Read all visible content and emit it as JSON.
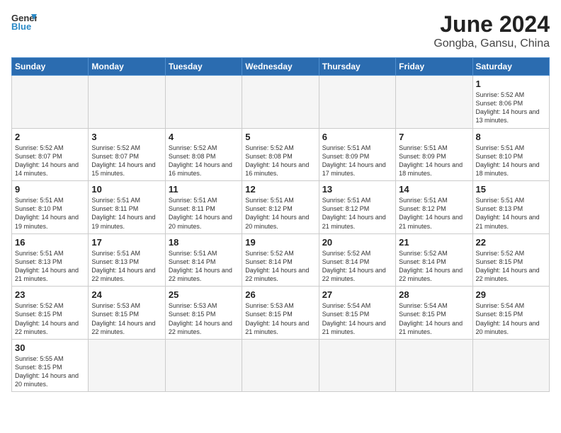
{
  "header": {
    "title": "June 2024",
    "location": "Gongba, Gansu, China",
    "logo_general": "General",
    "logo_blue": "Blue"
  },
  "days_of_week": [
    "Sunday",
    "Monday",
    "Tuesday",
    "Wednesday",
    "Thursday",
    "Friday",
    "Saturday"
  ],
  "weeks": [
    [
      {
        "day": "",
        "info": ""
      },
      {
        "day": "",
        "info": ""
      },
      {
        "day": "",
        "info": ""
      },
      {
        "day": "",
        "info": ""
      },
      {
        "day": "",
        "info": ""
      },
      {
        "day": "",
        "info": ""
      },
      {
        "day": "1",
        "info": "Sunrise: 5:52 AM\nSunset: 8:06 PM\nDaylight: 14 hours and 13 minutes."
      }
    ],
    [
      {
        "day": "2",
        "info": "Sunrise: 5:52 AM\nSunset: 8:07 PM\nDaylight: 14 hours and 14 minutes."
      },
      {
        "day": "3",
        "info": "Sunrise: 5:52 AM\nSunset: 8:07 PM\nDaylight: 14 hours and 15 minutes."
      },
      {
        "day": "4",
        "info": "Sunrise: 5:52 AM\nSunset: 8:08 PM\nDaylight: 14 hours and 16 minutes."
      },
      {
        "day": "5",
        "info": "Sunrise: 5:52 AM\nSunset: 8:08 PM\nDaylight: 14 hours and 16 minutes."
      },
      {
        "day": "6",
        "info": "Sunrise: 5:51 AM\nSunset: 8:09 PM\nDaylight: 14 hours and 17 minutes."
      },
      {
        "day": "7",
        "info": "Sunrise: 5:51 AM\nSunset: 8:09 PM\nDaylight: 14 hours and 18 minutes."
      },
      {
        "day": "8",
        "info": "Sunrise: 5:51 AM\nSunset: 8:10 PM\nDaylight: 14 hours and 18 minutes."
      }
    ],
    [
      {
        "day": "9",
        "info": "Sunrise: 5:51 AM\nSunset: 8:10 PM\nDaylight: 14 hours and 19 minutes."
      },
      {
        "day": "10",
        "info": "Sunrise: 5:51 AM\nSunset: 8:11 PM\nDaylight: 14 hours and 19 minutes."
      },
      {
        "day": "11",
        "info": "Sunrise: 5:51 AM\nSunset: 8:11 PM\nDaylight: 14 hours and 20 minutes."
      },
      {
        "day": "12",
        "info": "Sunrise: 5:51 AM\nSunset: 8:12 PM\nDaylight: 14 hours and 20 minutes."
      },
      {
        "day": "13",
        "info": "Sunrise: 5:51 AM\nSunset: 8:12 PM\nDaylight: 14 hours and 21 minutes."
      },
      {
        "day": "14",
        "info": "Sunrise: 5:51 AM\nSunset: 8:12 PM\nDaylight: 14 hours and 21 minutes."
      },
      {
        "day": "15",
        "info": "Sunrise: 5:51 AM\nSunset: 8:13 PM\nDaylight: 14 hours and 21 minutes."
      }
    ],
    [
      {
        "day": "16",
        "info": "Sunrise: 5:51 AM\nSunset: 8:13 PM\nDaylight: 14 hours and 21 minutes."
      },
      {
        "day": "17",
        "info": "Sunrise: 5:51 AM\nSunset: 8:13 PM\nDaylight: 14 hours and 22 minutes."
      },
      {
        "day": "18",
        "info": "Sunrise: 5:51 AM\nSunset: 8:14 PM\nDaylight: 14 hours and 22 minutes."
      },
      {
        "day": "19",
        "info": "Sunrise: 5:52 AM\nSunset: 8:14 PM\nDaylight: 14 hours and 22 minutes."
      },
      {
        "day": "20",
        "info": "Sunrise: 5:52 AM\nSunset: 8:14 PM\nDaylight: 14 hours and 22 minutes."
      },
      {
        "day": "21",
        "info": "Sunrise: 5:52 AM\nSunset: 8:14 PM\nDaylight: 14 hours and 22 minutes."
      },
      {
        "day": "22",
        "info": "Sunrise: 5:52 AM\nSunset: 8:15 PM\nDaylight: 14 hours and 22 minutes."
      }
    ],
    [
      {
        "day": "23",
        "info": "Sunrise: 5:52 AM\nSunset: 8:15 PM\nDaylight: 14 hours and 22 minutes."
      },
      {
        "day": "24",
        "info": "Sunrise: 5:53 AM\nSunset: 8:15 PM\nDaylight: 14 hours and 22 minutes."
      },
      {
        "day": "25",
        "info": "Sunrise: 5:53 AM\nSunset: 8:15 PM\nDaylight: 14 hours and 22 minutes."
      },
      {
        "day": "26",
        "info": "Sunrise: 5:53 AM\nSunset: 8:15 PM\nDaylight: 14 hours and 21 minutes."
      },
      {
        "day": "27",
        "info": "Sunrise: 5:54 AM\nSunset: 8:15 PM\nDaylight: 14 hours and 21 minutes."
      },
      {
        "day": "28",
        "info": "Sunrise: 5:54 AM\nSunset: 8:15 PM\nDaylight: 14 hours and 21 minutes."
      },
      {
        "day": "29",
        "info": "Sunrise: 5:54 AM\nSunset: 8:15 PM\nDaylight: 14 hours and 20 minutes."
      }
    ],
    [
      {
        "day": "30",
        "info": "Sunrise: 5:55 AM\nSunset: 8:15 PM\nDaylight: 14 hours and 20 minutes."
      },
      {
        "day": "",
        "info": ""
      },
      {
        "day": "",
        "info": ""
      },
      {
        "day": "",
        "info": ""
      },
      {
        "day": "",
        "info": ""
      },
      {
        "day": "",
        "info": ""
      },
      {
        "day": "",
        "info": ""
      }
    ]
  ]
}
